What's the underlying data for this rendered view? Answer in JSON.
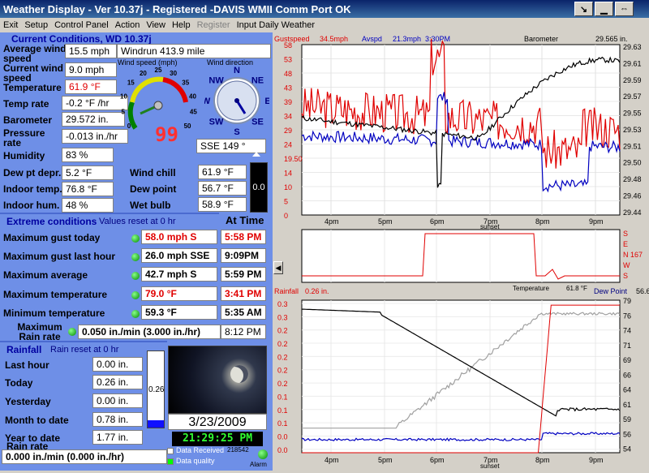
{
  "window": {
    "title": "Weather Display - Ver 10.37j - Registered  -DAVIS WMII  Comm Port OK"
  },
  "menu": [
    {
      "label": "Exit",
      "disabled": false
    },
    {
      "label": "Setup",
      "disabled": false
    },
    {
      "label": "Control Panel",
      "disabled": false
    },
    {
      "label": "Action",
      "disabled": false
    },
    {
      "label": "View",
      "disabled": false
    },
    {
      "label": "Help",
      "disabled": false
    },
    {
      "label": "Register",
      "disabled": true
    },
    {
      "label": "Input Daily Weather",
      "disabled": false
    }
  ],
  "current": {
    "header": "Current Conditions, WD 10.37j",
    "avg_wind_label": "Average wind speed",
    "avg_wind": "15.5 mph",
    "windrun": "Windrun 413.9 mile",
    "cur_wind_label": "Current wind speed",
    "cur_wind": "9.0 mph",
    "temp_label": "Temperature",
    "temp": "61.9 °F",
    "temp_rate_label": "Temp rate",
    "temp_rate": "-0.2 °F /hr",
    "baro_label": "Barometer",
    "baro": "29.572 in.",
    "press_rate_label": "Pressure rate",
    "press_rate": "-0.013 in./hr",
    "humidity_label": "Humidity",
    "humidity": "83 %",
    "dewdepr_label": "Dew pt depr.",
    "dewdepr": "5.2 °F",
    "indoor_temp_label": "Indoor temp.",
    "indoor_temp": "76.8 °F",
    "indoor_hum_label": "Indoor hum.",
    "indoor_hum": "48 %",
    "windchill_label": "Wind chill",
    "windchill": "61.9 °F",
    "dewpoint_label": "Dew point",
    "dewpoint": "56.7 °F",
    "wetbulb_label": "Wet bulb",
    "wetbulb": "58.9 °F",
    "side_value": "0.0",
    "digital": "99",
    "wind_gauge_title": "Wind speed (mph)",
    "wind_dir_title": "Wind direction",
    "wind_dir": "SSE  149 °",
    "gauge_ticks": [
      "0",
      "5",
      "10",
      "15",
      "20",
      "25",
      "30",
      "35",
      "40",
      "45",
      "50"
    ],
    "compass": [
      "N",
      "NE",
      "E",
      "SE",
      "S",
      "SW",
      "W",
      "NW"
    ]
  },
  "extreme": {
    "header": "Extreme conditions",
    "reset": "Values reset at 0 hr",
    "at_time": "At Time",
    "rows": [
      {
        "label": "Maximum gust today",
        "value": "58.0 mph  S",
        "time": "5:58 PM",
        "red": true
      },
      {
        "label": "Maximum gust last hour",
        "value": "26.0 mph SSE",
        "time": "9:09PM",
        "red": false
      },
      {
        "label": "Maximum average",
        "value": "42.7 mph   S",
        "time": "5:59 PM",
        "red": false
      },
      {
        "label": "Maximum temperature",
        "value": "79.0 °F",
        "time": "3:41 PM",
        "red": true
      },
      {
        "label": "Minimum temperature",
        "value": "59.3 °F",
        "time": "5:35 AM",
        "red": false
      }
    ],
    "rain_rate_label": "Maximum Rain rate",
    "rain_rate": "0.050 in./min (3.000 in./hr)",
    "rain_rate_time": "8:12 PM"
  },
  "rain": {
    "header": "Rainfall",
    "reset": "Rain reset at 0 hr",
    "rows": [
      {
        "label": "Last hour",
        "value": "0.00 in."
      },
      {
        "label": "Today",
        "value": "0.26 in."
      },
      {
        "label": "Yesterday",
        "value": "0.00 in."
      },
      {
        "label": "Month to date",
        "value": "0.78 in."
      },
      {
        "label": "Year to date",
        "value": "1.77 in."
      }
    ],
    "gauge_value": "0.26",
    "gauge_fill": 0.1,
    "rate_label": "Rain rate",
    "rate": "0.000 in./min (0.000 in./hr)",
    "date": "3/23/2009",
    "time": "21:29:25 PM",
    "data_received": "Data Received",
    "data_received_count": "218542",
    "data_quality": "Data quality",
    "alarm": "Alarm"
  },
  "charts": {
    "sunset": "sunset",
    "x_ticks": [
      "4pm",
      "5pm",
      "6pm",
      "7pm",
      "8pm",
      "9pm"
    ]
  },
  "chart_data": [
    {
      "type": "line",
      "title": "",
      "series": [
        {
          "name": "Gustspeed"
        },
        {
          "name": "Avspd"
        },
        {
          "name": "Barometer"
        }
      ],
      "header_values": [
        "34.5mph",
        "21.3mph",
        "3:30PM",
        "29.565 in."
      ],
      "left_axis": [
        0,
        4.83,
        9.67,
        14.5,
        19.33,
        24.17,
        29,
        33.83,
        38.67,
        43.5,
        48.33,
        53.17,
        58
      ],
      "left_labels": [
        "58",
        "53",
        "48",
        "43",
        "39",
        "34",
        "29",
        "24",
        "19.50",
        "14",
        "10",
        "5",
        "0"
      ],
      "right_labels": [
        "29.63",
        "29.61",
        "29.59",
        "29.57",
        "29.55",
        "29.53",
        "29.51",
        "29.50",
        "29.48",
        "29.46",
        "29.44"
      ],
      "ylim_left": [
        0,
        58
      ],
      "ylim_right": [
        29.44,
        29.63
      ]
    },
    {
      "type": "line",
      "title": "",
      "series": [
        {
          "name": "Wind direction"
        }
      ],
      "right_labels": [
        "S",
        "E",
        "N 167",
        "W",
        "S"
      ]
    },
    {
      "type": "line",
      "title": "",
      "series": [
        {
          "name": "Rainfall"
        },
        {
          "name": "Temperature"
        },
        {
          "name": "Dew Point"
        }
      ],
      "header_values": [
        "0.26 in.",
        "61.8 °F",
        "56.6"
      ],
      "left_labels": [
        "0.3",
        "0.3",
        "0.2",
        "0.2",
        "0.2",
        "0.2",
        "0.2",
        "0.1",
        "0.1",
        "0.1",
        "0.0",
        "0.0"
      ],
      "right_labels": [
        "79",
        "76",
        "74",
        "71",
        "69",
        "66",
        "64",
        "61",
        "59",
        "56",
        "54"
      ],
      "ylim_right": [
        54,
        79
      ]
    }
  ],
  "colors": {
    "title_bg": "#0a246a",
    "panel": "#6e8fe7",
    "red_value": "#e00000",
    "gust": "#e00000",
    "avg": "#0000c0",
    "baro": "#000000",
    "rain": "#e00000",
    "temp": "#000000",
    "dew": "#0000c0",
    "humidity": "#a0a0a0"
  }
}
